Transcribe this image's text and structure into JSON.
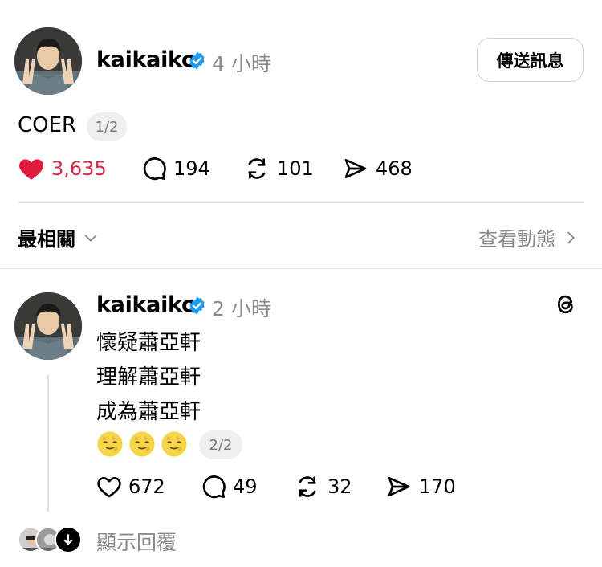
{
  "post1": {
    "username": "kaikaiko",
    "time": "4 小時",
    "send_message": "傳送訊息",
    "text": "COER",
    "page_indicator": "1/2",
    "likes": "3,635",
    "comments": "194",
    "reposts": "101",
    "shares": "468"
  },
  "filter": {
    "label": "最相關",
    "activity_label": "查看動態"
  },
  "post2": {
    "username": "kaikaiko",
    "time": "2 小時",
    "lines": [
      "懷疑蕭亞軒",
      "理解蕭亞軒",
      "成為蕭亞軒"
    ],
    "emoji": [
      "smiling-moon",
      "smiling-moon",
      "smiling-moon"
    ],
    "page_indicator": "2/2",
    "likes": "672",
    "comments": "49",
    "reposts": "32",
    "shares": "170"
  },
  "replies": {
    "label": "顯示回覆"
  },
  "colors": {
    "liked": "#d42a42",
    "verified": "#1d9bf0",
    "muted": "#8a8a8a"
  }
}
